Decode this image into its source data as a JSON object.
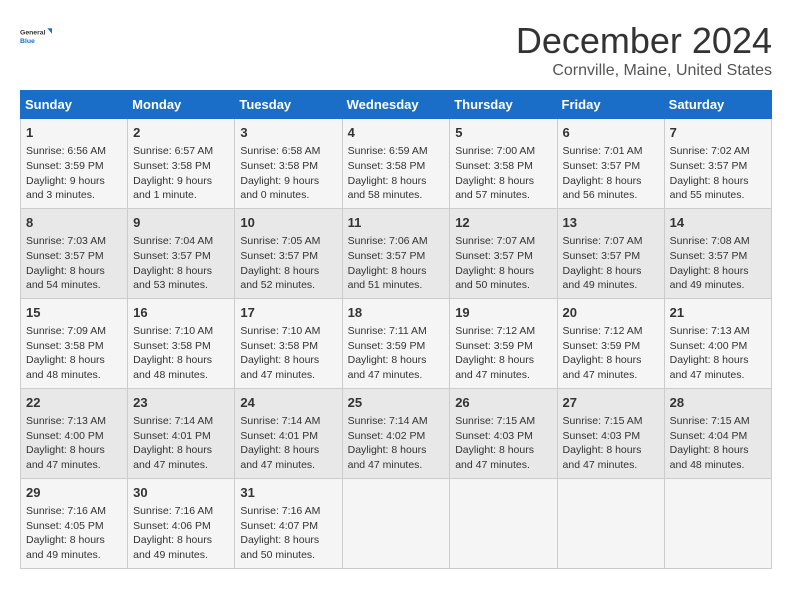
{
  "logo": {
    "line1": "General",
    "line2": "Blue"
  },
  "title": "December 2024",
  "location": "Cornville, Maine, United States",
  "days_of_week": [
    "Sunday",
    "Monday",
    "Tuesday",
    "Wednesday",
    "Thursday",
    "Friday",
    "Saturday"
  ],
  "weeks": [
    [
      {
        "day": "1",
        "sunrise": "6:56 AM",
        "sunset": "3:59 PM",
        "daylight": "9 hours and 3 minutes."
      },
      {
        "day": "2",
        "sunrise": "6:57 AM",
        "sunset": "3:58 PM",
        "daylight": "9 hours and 1 minute."
      },
      {
        "day": "3",
        "sunrise": "6:58 AM",
        "sunset": "3:58 PM",
        "daylight": "9 hours and 0 minutes."
      },
      {
        "day": "4",
        "sunrise": "6:59 AM",
        "sunset": "3:58 PM",
        "daylight": "8 hours and 58 minutes."
      },
      {
        "day": "5",
        "sunrise": "7:00 AM",
        "sunset": "3:58 PM",
        "daylight": "8 hours and 57 minutes."
      },
      {
        "day": "6",
        "sunrise": "7:01 AM",
        "sunset": "3:57 PM",
        "daylight": "8 hours and 56 minutes."
      },
      {
        "day": "7",
        "sunrise": "7:02 AM",
        "sunset": "3:57 PM",
        "daylight": "8 hours and 55 minutes."
      }
    ],
    [
      {
        "day": "8",
        "sunrise": "7:03 AM",
        "sunset": "3:57 PM",
        "daylight": "8 hours and 54 minutes."
      },
      {
        "day": "9",
        "sunrise": "7:04 AM",
        "sunset": "3:57 PM",
        "daylight": "8 hours and 53 minutes."
      },
      {
        "day": "10",
        "sunrise": "7:05 AM",
        "sunset": "3:57 PM",
        "daylight": "8 hours and 52 minutes."
      },
      {
        "day": "11",
        "sunrise": "7:06 AM",
        "sunset": "3:57 PM",
        "daylight": "8 hours and 51 minutes."
      },
      {
        "day": "12",
        "sunrise": "7:07 AM",
        "sunset": "3:57 PM",
        "daylight": "8 hours and 50 minutes."
      },
      {
        "day": "13",
        "sunrise": "7:07 AM",
        "sunset": "3:57 PM",
        "daylight": "8 hours and 49 minutes."
      },
      {
        "day": "14",
        "sunrise": "7:08 AM",
        "sunset": "3:57 PM",
        "daylight": "8 hours and 49 minutes."
      }
    ],
    [
      {
        "day": "15",
        "sunrise": "7:09 AM",
        "sunset": "3:58 PM",
        "daylight": "8 hours and 48 minutes."
      },
      {
        "day": "16",
        "sunrise": "7:10 AM",
        "sunset": "3:58 PM",
        "daylight": "8 hours and 48 minutes."
      },
      {
        "day": "17",
        "sunrise": "7:10 AM",
        "sunset": "3:58 PM",
        "daylight": "8 hours and 47 minutes."
      },
      {
        "day": "18",
        "sunrise": "7:11 AM",
        "sunset": "3:59 PM",
        "daylight": "8 hours and 47 minutes."
      },
      {
        "day": "19",
        "sunrise": "7:12 AM",
        "sunset": "3:59 PM",
        "daylight": "8 hours and 47 minutes."
      },
      {
        "day": "20",
        "sunrise": "7:12 AM",
        "sunset": "3:59 PM",
        "daylight": "8 hours and 47 minutes."
      },
      {
        "day": "21",
        "sunrise": "7:13 AM",
        "sunset": "4:00 PM",
        "daylight": "8 hours and 47 minutes."
      }
    ],
    [
      {
        "day": "22",
        "sunrise": "7:13 AM",
        "sunset": "4:00 PM",
        "daylight": "8 hours and 47 minutes."
      },
      {
        "day": "23",
        "sunrise": "7:14 AM",
        "sunset": "4:01 PM",
        "daylight": "8 hours and 47 minutes."
      },
      {
        "day": "24",
        "sunrise": "7:14 AM",
        "sunset": "4:01 PM",
        "daylight": "8 hours and 47 minutes."
      },
      {
        "day": "25",
        "sunrise": "7:14 AM",
        "sunset": "4:02 PM",
        "daylight": "8 hours and 47 minutes."
      },
      {
        "day": "26",
        "sunrise": "7:15 AM",
        "sunset": "4:03 PM",
        "daylight": "8 hours and 47 minutes."
      },
      {
        "day": "27",
        "sunrise": "7:15 AM",
        "sunset": "4:03 PM",
        "daylight": "8 hours and 47 minutes."
      },
      {
        "day": "28",
        "sunrise": "7:15 AM",
        "sunset": "4:04 PM",
        "daylight": "8 hours and 48 minutes."
      }
    ],
    [
      {
        "day": "29",
        "sunrise": "7:16 AM",
        "sunset": "4:05 PM",
        "daylight": "8 hours and 49 minutes."
      },
      {
        "day": "30",
        "sunrise": "7:16 AM",
        "sunset": "4:06 PM",
        "daylight": "8 hours and 49 minutes."
      },
      {
        "day": "31",
        "sunrise": "7:16 AM",
        "sunset": "4:07 PM",
        "daylight": "8 hours and 50 minutes."
      },
      null,
      null,
      null,
      null
    ]
  ],
  "labels": {
    "sunrise": "Sunrise:",
    "sunset": "Sunset:",
    "daylight": "Daylight:"
  }
}
